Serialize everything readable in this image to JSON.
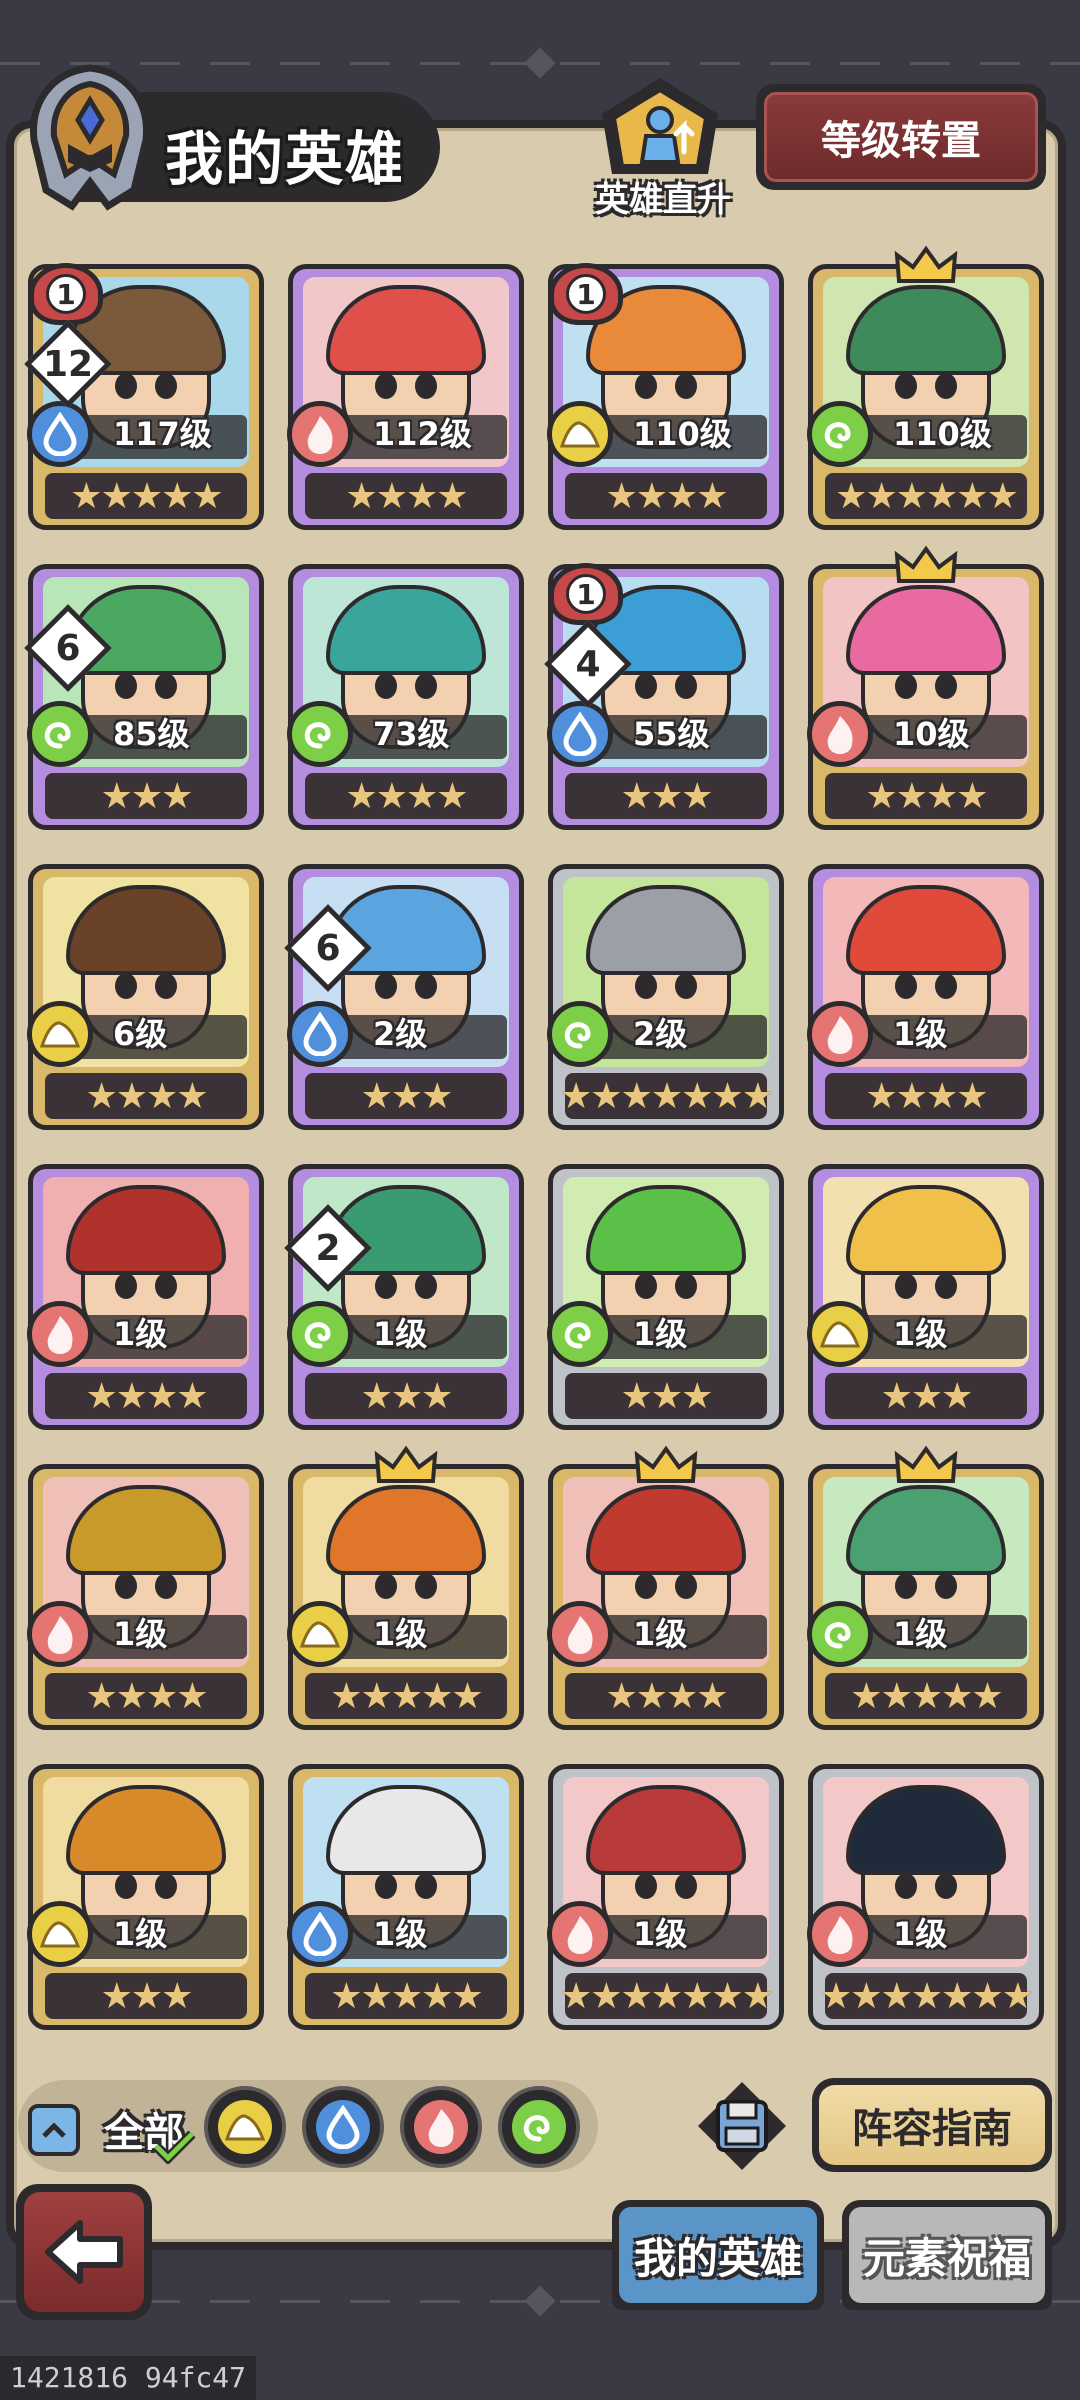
{
  "header": {
    "title": "我的英雄",
    "direct_upgrade_label": "英雄直升",
    "level_transfer_label": "等级转置"
  },
  "heroes": [
    {
      "level": "117级",
      "element": "water",
      "stars": 5,
      "frame": "gold",
      "hair": "#7a5a3a",
      "bg": "#a8d8ea",
      "circle_badge": "1",
      "diamond_badge": "12",
      "crown": false
    },
    {
      "level": "112级",
      "element": "fire",
      "stars": 4,
      "frame": "purple",
      "hair": "#e0504a",
      "bg": "#f2c7c9",
      "circle_badge": "",
      "diamond_badge": "",
      "crown": false
    },
    {
      "level": "110级",
      "element": "earth",
      "stars": 4,
      "frame": "purple",
      "hair": "#e88a3a",
      "bg": "#bfe0f0",
      "circle_badge": "1",
      "diamond_badge": "",
      "crown": false
    },
    {
      "level": "110级",
      "element": "wind",
      "stars": 6,
      "frame": "gold",
      "hair": "#3f8a5a",
      "bg": "#cfe6b0",
      "circle_badge": "",
      "diamond_badge": "",
      "crown": true
    },
    {
      "level": "85级",
      "element": "wind",
      "stars": 3,
      "frame": "purple",
      "hair": "#4aa860",
      "bg": "#b8e6b8",
      "circle_badge": "",
      "diamond_badge": "6",
      "crown": false
    },
    {
      "level": "73级",
      "element": "wind",
      "stars": 4,
      "frame": "purple",
      "hair": "#3aa59a",
      "bg": "#bde6d8",
      "circle_badge": "",
      "diamond_badge": "",
      "crown": false
    },
    {
      "level": "55级",
      "element": "water",
      "stars": 3,
      "frame": "purple",
      "hair": "#3b9fd6",
      "bg": "#b8dcf0",
      "circle_badge": "1",
      "diamond_badge": "4",
      "crown": false
    },
    {
      "level": "10级",
      "element": "fire",
      "stars": 4,
      "frame": "gold",
      "hair": "#e86aa0",
      "bg": "#f3c4c4",
      "circle_badge": "",
      "diamond_badge": "",
      "crown": true
    },
    {
      "level": "6级",
      "element": "earth",
      "stars": 4,
      "frame": "gold",
      "hair": "#6a4228",
      "bg": "#f0e2a0",
      "circle_badge": "",
      "diamond_badge": "",
      "crown": false
    },
    {
      "level": "2级",
      "element": "water",
      "stars": 3,
      "frame": "purple",
      "hair": "#5aa4e0",
      "bg": "#c8def3",
      "circle_badge": "",
      "diamond_badge": "6",
      "crown": false
    },
    {
      "level": "2级",
      "element": "wind",
      "stars": 7,
      "frame": "silver",
      "hair": "#9aa0a6",
      "bg": "#c4e69a",
      "circle_badge": "",
      "diamond_badge": "",
      "crown": false
    },
    {
      "level": "1级",
      "element": "fire",
      "stars": 4,
      "frame": "purple",
      "hair": "#e04a3a",
      "bg": "#f3b8b8",
      "circle_badge": "",
      "diamond_badge": "",
      "crown": false
    },
    {
      "level": "1级",
      "element": "fire",
      "stars": 4,
      "frame": "purple",
      "hair": "#b0322c",
      "bg": "#f0b0b0",
      "circle_badge": "",
      "diamond_badge": "",
      "crown": false
    },
    {
      "level": "1级",
      "element": "wind",
      "stars": 3,
      "frame": "purple",
      "hair": "#3a9a70",
      "bg": "#c0e8c8",
      "circle_badge": "",
      "diamond_badge": "2",
      "crown": false
    },
    {
      "level": "1级",
      "element": "wind",
      "stars": 3,
      "frame": "silver",
      "hair": "#5ac048",
      "bg": "#d0ecb0",
      "circle_badge": "",
      "diamond_badge": "",
      "crown": false
    },
    {
      "level": "1级",
      "element": "earth",
      "stars": 3,
      "frame": "purple",
      "hair": "#f0c04a",
      "bg": "#f3e0b0",
      "circle_badge": "",
      "diamond_badge": "",
      "crown": false
    },
    {
      "level": "1级",
      "element": "fire",
      "stars": 4,
      "frame": "gold",
      "hair": "#c89a2a",
      "bg": "#f0c0b8",
      "circle_badge": "",
      "diamond_badge": "",
      "crown": false
    },
    {
      "level": "1级",
      "element": "earth",
      "stars": 5,
      "frame": "gold",
      "hair": "#e0762a",
      "bg": "#f0dca0",
      "circle_badge": "",
      "diamond_badge": "",
      "crown": true
    },
    {
      "level": "1级",
      "element": "fire",
      "stars": 4,
      "frame": "gold",
      "hair": "#c03a30",
      "bg": "#f0c0b8",
      "circle_badge": "",
      "diamond_badge": "",
      "crown": true
    },
    {
      "level": "1级",
      "element": "wind",
      "stars": 5,
      "frame": "gold",
      "hair": "#4aa070",
      "bg": "#c8e8c0",
      "circle_badge": "",
      "diamond_badge": "",
      "crown": true
    },
    {
      "level": "1级",
      "element": "earth",
      "stars": 3,
      "frame": "gold",
      "hair": "#d88a2a",
      "bg": "#f0dca0",
      "circle_badge": "",
      "diamond_badge": "",
      "crown": false
    },
    {
      "level": "1级",
      "element": "water",
      "stars": 5,
      "frame": "gold",
      "hair": "#e8e8e8",
      "bg": "#bfe0f0",
      "circle_badge": "",
      "diamond_badge": "",
      "crown": false
    },
    {
      "level": "1级",
      "element": "fire",
      "stars": 7,
      "frame": "silver",
      "hair": "#b83a3a",
      "bg": "#f3c8c8",
      "circle_badge": "",
      "diamond_badge": "",
      "crown": false
    },
    {
      "level": "1级",
      "element": "fire",
      "stars": 7,
      "frame": "silver",
      "hair": "#1f2a3a",
      "bg": "#f3c8c8",
      "circle_badge": "",
      "diamond_badge": "",
      "crown": false
    }
  ],
  "filters": {
    "all_label": "全部",
    "elements": [
      "earth",
      "water",
      "fire",
      "wind"
    ]
  },
  "actions": {
    "lineup_guide_label": "阵容指南"
  },
  "tabs": {
    "my_heroes": "我的英雄",
    "element_blessing": "元素祝福"
  },
  "footer": {
    "id_text": "1421816 94fc47"
  },
  "colors": {
    "panel": "#d9ccae",
    "dark": "#2c2a2c",
    "water": "#4f8fdb",
    "fire": "#e57573",
    "earth": "#e8cf45",
    "wind": "#7ccf46"
  }
}
